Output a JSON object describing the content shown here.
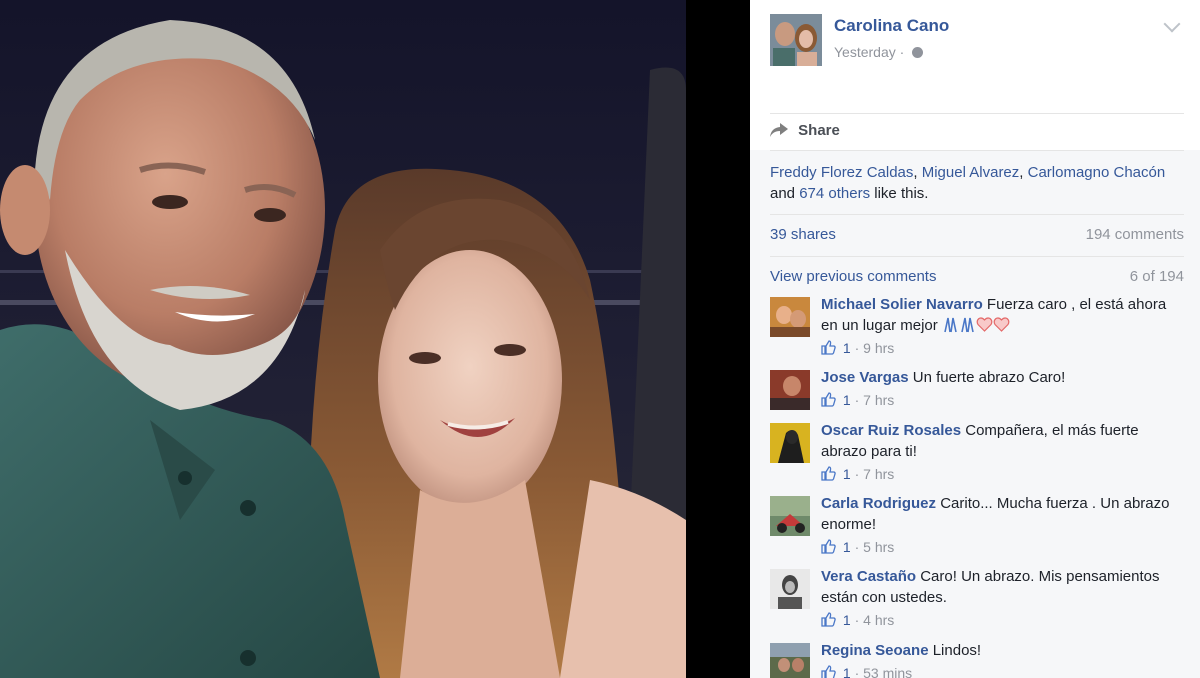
{
  "post": {
    "author": "Carolina Cano",
    "time": "Yesterday",
    "separator": "·",
    "share_label": "Share",
    "likes": {
      "names": [
        "Freddy Florez Caldas",
        "Miguel Alvarez",
        "Carlomagno Chacón"
      ],
      "and_text": "and",
      "others": "674 others",
      "suffix": "like this."
    },
    "shares": "39 shares",
    "comments_count": "194 comments",
    "view_previous": "View previous comments",
    "page_count": "6 of 194"
  },
  "comments": [
    {
      "name": "Michael Solier Navarro",
      "text": "Fuerza caro , el está ahora en un lugar mejor",
      "likes": "1",
      "time": "9 hrs",
      "avatar_color": "#c9883d"
    },
    {
      "name": "Jose Vargas",
      "text": "Un fuerte abrazo Caro!",
      "likes": "1",
      "time": "7 hrs",
      "avatar_color": "#8a3a2a"
    },
    {
      "name": "Oscar Ruiz Rosales",
      "text": "Compañera, el más fuerte abrazo para ti!",
      "likes": "1",
      "time": "7 hrs",
      "avatar_color": "#d8b320"
    },
    {
      "name": "Carla Rodriguez",
      "text": "Carito... Mucha fuerza . Un abrazo enorme!",
      "likes": "1",
      "time": "5 hrs",
      "avatar_color": "#6f8a6a"
    },
    {
      "name": "Vera Castaño",
      "text": "Caro! Un abrazo. Mis pensamientos están con ustedes.",
      "likes": "1",
      "time": "4 hrs",
      "avatar_color": "#9c9c9c"
    },
    {
      "name": "Regina Seoane",
      "text": "Lindos!",
      "likes": "1",
      "time": "53 mins",
      "avatar_color": "#5c6a4a"
    }
  ],
  "icons": {
    "share": "share-icon",
    "globe": "globe-icon",
    "chevron": "chevron-down-icon",
    "like": "thumbs-up-icon"
  },
  "colors": {
    "link": "#365899",
    "muted": "#90949c",
    "panel_bg": "#f6f7f9"
  }
}
